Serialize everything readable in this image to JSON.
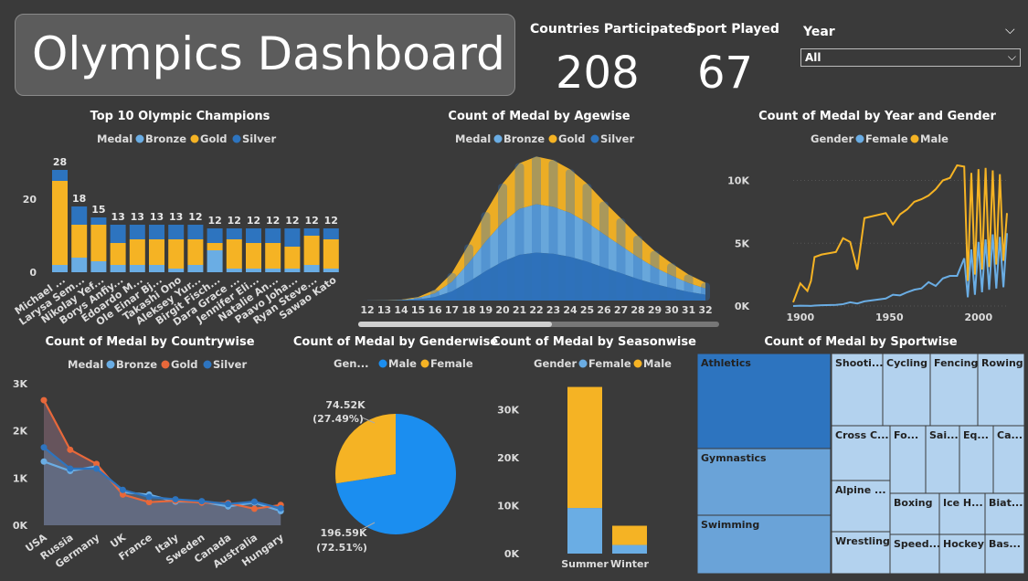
{
  "header": {
    "title": "Olympics Dashboard",
    "countries_label": "Countries Participated",
    "countries_value": "208",
    "sports_label": "Sport Played",
    "sports_value": "67"
  },
  "slicer": {
    "label": "Year",
    "value": "All"
  },
  "colors": {
    "bronze": "#6aade4",
    "gold": "#f5b324",
    "silver": "#2d74bf",
    "female": "#6aade4",
    "male": "#f5b324",
    "gold_line": "#e8683a",
    "pie_male": "#1b8ef0",
    "background": "#3a3a3a"
  },
  "legend_labels": {
    "medal": "Medal",
    "bronze": "Bronze",
    "gold": "Gold",
    "silver": "Silver",
    "gender": "Gender",
    "female": "Female",
    "male": "Male",
    "gender_short": "Gen..."
  },
  "chart_data": [
    {
      "id": "champions",
      "type": "bar",
      "title": "Top 10 Olympic Champions",
      "categories": [
        "Michael ...",
        "Larysa Sem...",
        "Nikolay Yef...",
        "Borys Anfiy...",
        "Edoardo M...",
        "Ole Einar Bj...",
        "Takashi Ono",
        "Aleksey Yur...",
        "Birgit Fisch...",
        "Dara Grace ...",
        "Jennifer Eli...",
        "Natalie An...",
        "Paavo Joha...",
        "Ryan Steve...",
        "Sawao Kato"
      ],
      "series": [
        {
          "name": "Bronze",
          "values": [
            2,
            4,
            3,
            2,
            2,
            2,
            1,
            2,
            6,
            1,
            1,
            1,
            1,
            2,
            1
          ]
        },
        {
          "name": "Gold",
          "values": [
            23,
            9,
            10,
            6,
            7,
            7,
            8,
            7,
            2,
            8,
            7,
            7,
            6,
            8,
            8
          ]
        },
        {
          "name": "Silver",
          "values": [
            3,
            5,
            2,
            5,
            4,
            4,
            4,
            4,
            4,
            3,
            4,
            4,
            5,
            2,
            3
          ]
        }
      ],
      "totals": [
        28,
        18,
        15,
        13,
        13,
        13,
        13,
        12,
        12,
        12,
        12,
        12,
        12,
        12,
        12
      ],
      "y_ticks": [
        "0",
        "20"
      ],
      "ylim": [
        0,
        30
      ]
    },
    {
      "id": "agewise",
      "type": "area",
      "title": "Count of Medal by Agewise",
      "categories": [
        "12",
        "13",
        "14",
        "15",
        "16",
        "17",
        "18",
        "19",
        "20",
        "21",
        "22",
        "23",
        "24",
        "25",
        "26",
        "27",
        "28",
        "29",
        "30",
        "31",
        "32"
      ],
      "series": [
        {
          "name": "Bronze",
          "values": [
            2,
            4,
            10,
            40,
            110,
            280,
            560,
            870,
            1150,
            1350,
            1420,
            1380,
            1290,
            1150,
            980,
            810,
            640,
            490,
            370,
            260,
            180
          ]
        },
        {
          "name": "Gold",
          "values": [
            1,
            3,
            8,
            30,
            100,
            260,
            540,
            860,
            1140,
            1340,
            1400,
            1370,
            1280,
            1140,
            960,
            800,
            630,
            480,
            360,
            250,
            170
          ]
        },
        {
          "name": "Silver",
          "values": [
            1,
            3,
            9,
            35,
            105,
            270,
            550,
            865,
            1145,
            1345,
            1410,
            1375,
            1285,
            1145,
            970,
            805,
            635,
            485,
            365,
            255,
            175
          ]
        }
      ]
    },
    {
      "id": "year_gender",
      "type": "line",
      "title": "Count of Medal by Year and Gender",
      "x": [
        1896,
        1900,
        1904,
        1906,
        1908,
        1912,
        1920,
        1924,
        1928,
        1932,
        1936,
        1948,
        1952,
        1956,
        1960,
        1964,
        1968,
        1972,
        1976,
        1980,
        1984,
        1988,
        1992,
        1994,
        1996,
        1998,
        2000,
        2002,
        2004,
        2006,
        2008,
        2010,
        2012,
        2014,
        2016
      ],
      "series": [
        {
          "name": "Female",
          "values": [
            0,
            30,
            20,
            10,
            40,
            60,
            90,
            150,
            300,
            200,
            370,
            600,
            900,
            850,
            1100,
            1300,
            1400,
            1900,
            1600,
            2200,
            2400,
            2400,
            3800,
            700,
            4500,
            900,
            5100,
            1100,
            5300,
            1300,
            5700,
            1400,
            5500,
            1500,
            5800
          ]
        },
        {
          "name": "Male",
          "values": [
            300,
            1800,
            1200,
            2000,
            3900,
            4100,
            4300,
            5400,
            5100,
            2900,
            7000,
            7400,
            6500,
            7300,
            7700,
            8300,
            8500,
            8800,
            9300,
            10000,
            10200,
            11200,
            11100,
            2000,
            10600,
            2500,
            10900,
            2900,
            11000,
            3100,
            10800,
            3300,
            10500,
            3600,
            7400
          ]
        }
      ],
      "x_ticks": [
        "1900",
        "1950",
        "2000"
      ],
      "y_ticks": [
        "0K",
        "5K",
        "10K"
      ],
      "ylim": [
        0,
        12000
      ]
    },
    {
      "id": "countrywise",
      "type": "area",
      "title": "Count of Medal by Countrywise",
      "categories": [
        "USA",
        "Russia",
        "Germany",
        "UK",
        "France",
        "Italy",
        "Sweden",
        "Canada",
        "Australia",
        "Hungary"
      ],
      "series": [
        {
          "name": "Bronze",
          "values": [
            1350,
            1150,
            1250,
            700,
            650,
            500,
            500,
            400,
            480,
            300
          ]
        },
        {
          "name": "Gold",
          "values": [
            2650,
            1600,
            1300,
            650,
            490,
            520,
            480,
            470,
            350,
            430
          ]
        },
        {
          "name": "Silver",
          "values": [
            1650,
            1200,
            1200,
            750,
            600,
            550,
            510,
            450,
            500,
            360
          ]
        }
      ],
      "y_ticks": [
        "0K",
        "1K",
        "2K",
        "3K"
      ],
      "ylim": [
        0,
        3000
      ]
    },
    {
      "id": "genderwise",
      "type": "pie",
      "title": "Count of Medal by Genderwise",
      "slices": [
        {
          "name": "Male",
          "value": 196594,
          "label": "196.59K",
          "pct": "(72.51%)"
        },
        {
          "name": "Female",
          "value": 74522,
          "label": "74.52K",
          "pct": "(27.49%)"
        }
      ]
    },
    {
      "id": "seasonwise",
      "type": "bar",
      "title": "Count of Medal by Seasonwise",
      "categories": [
        "Summer",
        "Winter"
      ],
      "series": [
        {
          "name": "Female",
          "values": [
            9500,
            1800
          ]
        },
        {
          "name": "Male",
          "values": [
            25200,
            4000
          ]
        }
      ],
      "y_ticks": [
        "0K",
        "10K",
        "20K",
        "30K"
      ],
      "ylim": [
        0,
        35000
      ]
    },
    {
      "id": "sportwise",
      "type": "treemap",
      "title": "Count of Medal by Sportwise",
      "items": [
        {
          "label": "Athletics",
          "shade": "dark"
        },
        {
          "label": "Gymnastics",
          "shade": "mid"
        },
        {
          "label": "Swimming",
          "shade": "mid"
        },
        {
          "label": "Shooti...",
          "shade": "light"
        },
        {
          "label": "Cycling",
          "shade": "light"
        },
        {
          "label": "Fencing",
          "shade": "light"
        },
        {
          "label": "Rowing",
          "shade": "light"
        },
        {
          "label": "Cross C...",
          "shade": "light"
        },
        {
          "label": "Fo...",
          "shade": "light"
        },
        {
          "label": "Sai...",
          "shade": "light"
        },
        {
          "label": "Eq...",
          "shade": "light"
        },
        {
          "label": "Ca...",
          "shade": "light"
        },
        {
          "label": "Alpine ...",
          "shade": "light"
        },
        {
          "label": "Boxing",
          "shade": "light"
        },
        {
          "label": "Ice H...",
          "shade": "light"
        },
        {
          "label": "Biat...",
          "shade": "light"
        },
        {
          "label": "Wrestling",
          "shade": "light"
        },
        {
          "label": "Speed...",
          "shade": "light"
        },
        {
          "label": "Hockey",
          "shade": "light"
        },
        {
          "label": "Bas...",
          "shade": "light"
        }
      ]
    }
  ]
}
